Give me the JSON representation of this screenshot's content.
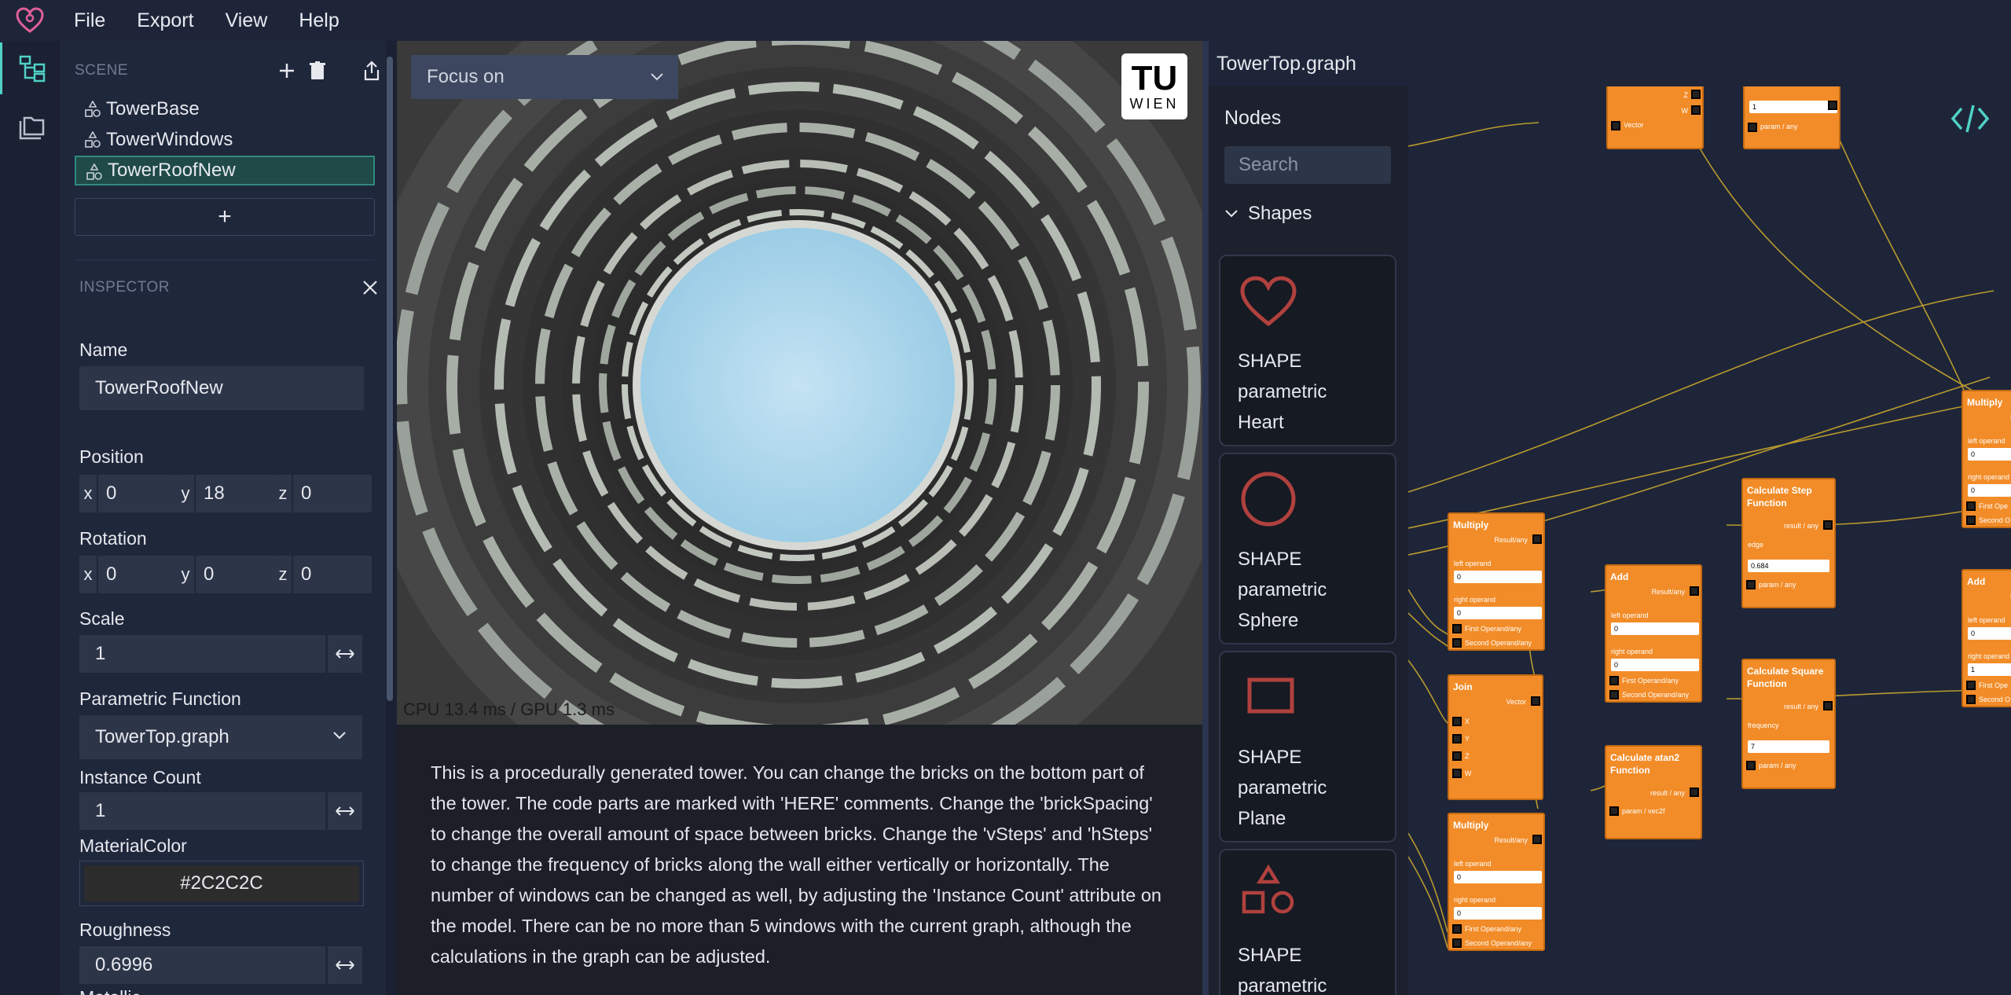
{
  "menu": [
    "File",
    "Export",
    "View",
    "Help"
  ],
  "scene": {
    "title": "SCENE",
    "items": [
      "TowerBase",
      "TowerWindows",
      "TowerRoofNew"
    ],
    "add_label": "+"
  },
  "inspector": {
    "title": "INSPECTOR",
    "name_label": "Name",
    "name_value": "TowerRoofNew",
    "position_label": "Position",
    "position": {
      "x": "0",
      "y": "18",
      "z": "0"
    },
    "rotation_label": "Rotation",
    "rotation": {
      "x": "0",
      "y": "0",
      "z": "0"
    },
    "axis_labels": {
      "x": "x",
      "y": "y",
      "z": "z"
    },
    "scale_label": "Scale",
    "scale_value": "1",
    "function_label": "Parametric Function",
    "function_value": "TowerTop.graph",
    "instance_label": "Instance Count",
    "instance_value": "1",
    "material_label": "MaterialColor",
    "material_value": "#2C2C2C",
    "roughness_label": "Roughness",
    "roughness_value": "0.6996",
    "metallic_label": "Metallic"
  },
  "viewport": {
    "focus_placeholder": "Focus on",
    "logo_top": "TU",
    "logo_bottom": "WIEN",
    "perf": "CPU 13.4 ms / GPU 1.3 ms"
  },
  "description": "This is a procedurally generated tower. You can change the bricks on the bottom part of the tower. The code parts are marked with 'HERE' comments. Change the 'brickSpacing' to change the overall amount of space between bricks. Change the 'vSteps' and 'hSteps' to change the frequency of bricks along the wall either vertically or horizontally. The number of windows can be changed as well, by adjusting the 'Instance Count' attribute on the model. There can be no more than 5 windows with the current graph, although the calculations in the graph can be adjusted.",
  "graph": {
    "title": "TowerTop.graph",
    "nodes_title": "Nodes",
    "search_placeholder": "Search",
    "category": "Shapes",
    "shapes": [
      {
        "l1": "SHAPE",
        "l2": "parametric",
        "l3": "Heart"
      },
      {
        "l1": "SHAPE",
        "l2": "parametric",
        "l3": "Sphere"
      },
      {
        "l1": "SHAPE",
        "l2": "parametric",
        "l3": "Plane"
      },
      {
        "l1": "SHAPE",
        "l2": "parametric",
        "l3": ""
      }
    ],
    "accent": "#f28c28",
    "shape_color": "#b0413e",
    "nodes": {
      "top_vector": {
        "port": "Vector",
        "z": "Z",
        "w": "W"
      },
      "top_param": {
        "value": "1",
        "port": "param / any"
      },
      "multiply1": {
        "title": "Multiply",
        "result": "Result/any",
        "left": "left operand",
        "lv": "0",
        "right": "right operand",
        "rv": "0",
        "first": "First Operand/any",
        "second": "Second Operand/any"
      },
      "join": {
        "title": "Join",
        "vector": "Vector",
        "x": "X",
        "y": "Y",
        "z": "Z",
        "w": "W"
      },
      "multiply2": {
        "title": "Multiply",
        "result": "Result/any",
        "left": "left operand",
        "lv": "0",
        "right": "right operand",
        "rv": "0",
        "first": "First Operand/any",
        "second": "Second Operand/any"
      },
      "add1": {
        "title": "Add",
        "result": "Result/any",
        "left": "left operand",
        "lv": "0",
        "right": "right operand",
        "rv": "0",
        "first": "First Operand/any",
        "second": "Second Operand/any"
      },
      "atan2": {
        "title": "Calculate atan2 Function",
        "result": "result / any",
        "param": "param / vec2f"
      },
      "step": {
        "title": "Calculate Step Function",
        "result": "result / any",
        "edge": "edge",
        "ev": "0.684",
        "param": "param / any"
      },
      "square": {
        "title": "Calculate Square Function",
        "result": "result / any",
        "freq": "frequency",
        "fv": "7",
        "param": "param / any"
      },
      "multiply3": {
        "title": "Multiply",
        "res": "R",
        "left": "left operand",
        "lv": "0",
        "right": "right operand",
        "rv": "0",
        "first": "First Ope",
        "second": "Second O"
      },
      "add2": {
        "title": "Add",
        "res": "R",
        "left": "left operand",
        "lv": "0",
        "right": "right operand",
        "rv": "1",
        "first": "First Ope",
        "second": "Second O"
      }
    }
  }
}
